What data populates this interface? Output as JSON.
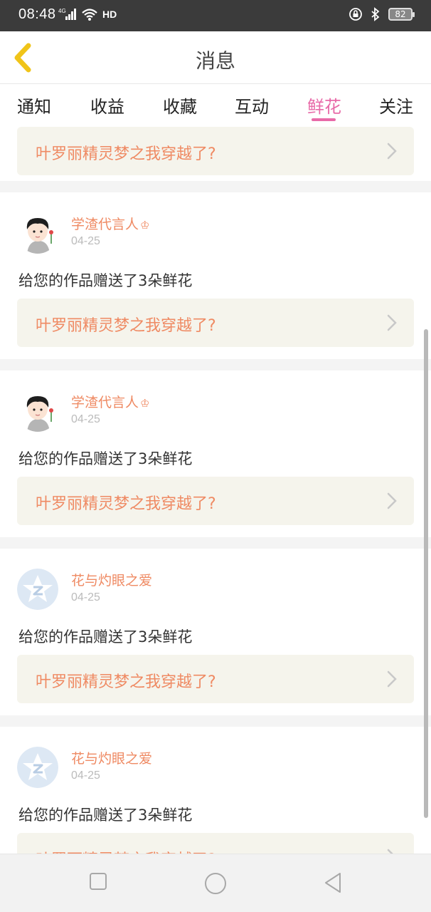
{
  "status_bar": {
    "time": "08:48",
    "network": "4G",
    "hd": "HD",
    "battery": "82"
  },
  "header": {
    "title": "消息"
  },
  "tabs": [
    {
      "label": "通知"
    },
    {
      "label": "收益"
    },
    {
      "label": "收藏"
    },
    {
      "label": "互动"
    },
    {
      "label": "鲜花",
      "active": true
    },
    {
      "label": "关注"
    }
  ],
  "feed": {
    "partial_top_card": {
      "work_title": "叶罗丽精灵梦之我穿越了?"
    },
    "items": [
      {
        "username": "学渣代言人",
        "badge": "♔",
        "date": "04-25",
        "message": "给您的作品赠送了3朵鲜花",
        "work_title": "叶罗丽精灵梦之我穿越了?",
        "avatar": "cartoon-boy"
      },
      {
        "username": "学渣代言人",
        "badge": "♔",
        "date": "04-25",
        "message": "给您的作品赠送了3朵鲜花",
        "work_title": "叶罗丽精灵梦之我穿越了?",
        "avatar": "cartoon-boy"
      },
      {
        "username": "花与灼眼之爱",
        "badge": "",
        "date": "04-25",
        "message": "给您的作品赠送了3朵鲜花",
        "work_title": "叶罗丽精灵梦之我穿越了?",
        "avatar": "default-star"
      },
      {
        "username": "花与灼眼之爱",
        "badge": "",
        "date": "04-25",
        "message": "给您的作品赠送了3朵鲜花",
        "work_title": "叶罗丽精灵梦之我穿越了?",
        "avatar": "default-star"
      }
    ]
  },
  "colors": {
    "accent_pink": "#e86aa8",
    "accent_orange": "#ef8a63",
    "back_arrow": "#f0c419",
    "work_box_bg": "#f5f4ec"
  }
}
